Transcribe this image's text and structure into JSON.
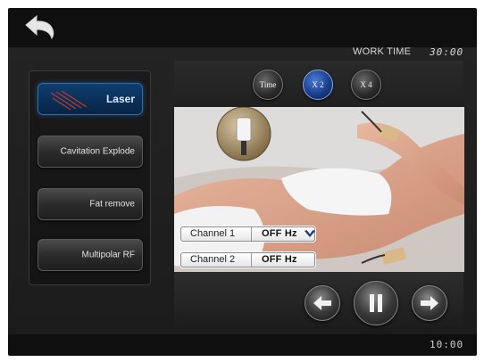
{
  "header": {
    "back_icon": "back-arrow-icon",
    "work_time_label": "WORK TIME",
    "work_time_value": "30:00"
  },
  "sidebar": {
    "modes": [
      {
        "label": "Laser",
        "active": true
      },
      {
        "label": "Cavitation Explode",
        "active": false
      },
      {
        "label": "Fat remove",
        "active": false
      },
      {
        "label": "Multipolar RF",
        "active": false
      }
    ]
  },
  "top_controls": {
    "time_label": "Time",
    "x2_label": "X 2",
    "x4_label": "X 4"
  },
  "channels": [
    {
      "label": "Channel 1",
      "value": "OFF Hz"
    },
    {
      "label": "Channel 2",
      "value": "OFF Hz"
    }
  ],
  "playback": {
    "prev_icon": "left-arrow-icon",
    "pause_icon": "pause-icon",
    "next_icon": "right-arrow-icon"
  },
  "footer": {
    "clock": "10:00"
  },
  "colors": {
    "background": "#0f0f0f",
    "active_mode": "#0a2e55",
    "accent_blue": "#2f6cae",
    "text": "#d8d8d8"
  }
}
